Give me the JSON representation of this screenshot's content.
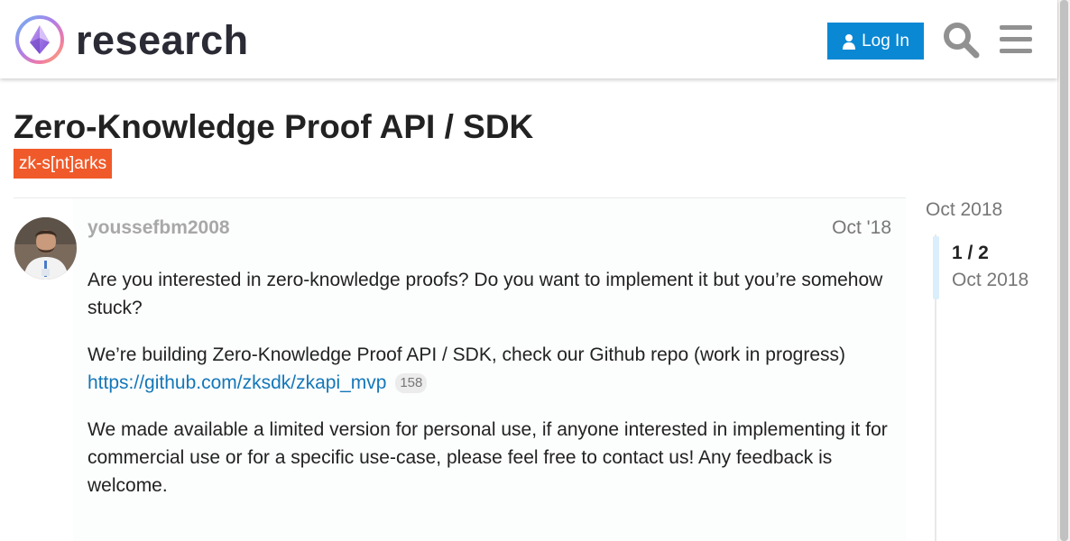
{
  "header": {
    "logo_text": "research",
    "login_label": "Log In",
    "accent_color": "#0a88d4"
  },
  "topic": {
    "title": "Zero-Knowledge Proof API / SDK",
    "category": "zk-s[nt]arks",
    "category_color": "#f05a2a"
  },
  "post": {
    "username": "youssefbm2008",
    "date": "Oct '18",
    "paragraph_1": "Are you interested in zero-knowledge proofs? Do you want to implement it but you’re somehow stuck?",
    "paragraph_2": "We’re building Zero-Knowledge Proof API / SDK, check our Github repo (work in progress)",
    "link": "https://github.com/zksdk/zkapi_mvp",
    "link_clicks": "158",
    "paragraph_3": "We made available a limited version for personal use, if anyone interested in implementing it for commercial use or for a specific use-case, please feel free to contact us! Any feedback is welcome."
  },
  "timeline": {
    "top_date": "Oct 2018",
    "progress": "1 / 2",
    "current_date": "Oct 2018"
  }
}
